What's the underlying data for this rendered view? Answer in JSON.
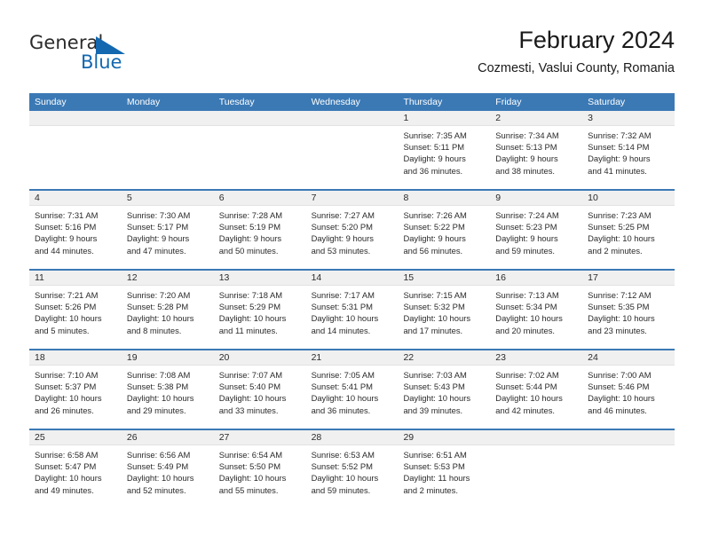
{
  "logo": {
    "word1": "General",
    "word2": "Blue",
    "triangle_color": "#1368b0"
  },
  "header": {
    "month_title": "February 2024",
    "location": "Cozmesti, Vaslui County, Romania"
  },
  "theme": {
    "header_blue": "#3b79b5",
    "banner_grey": "#f0f0f0",
    "text": "#2a2a2a"
  },
  "calendar": {
    "weekday_headers": [
      "Sunday",
      "Monday",
      "Tuesday",
      "Wednesday",
      "Thursday",
      "Friday",
      "Saturday"
    ],
    "weeks": [
      [
        {
          "day": "",
          "lines": []
        },
        {
          "day": "",
          "lines": []
        },
        {
          "day": "",
          "lines": []
        },
        {
          "day": "",
          "lines": []
        },
        {
          "day": "1",
          "lines": [
            "Sunrise: 7:35 AM",
            "Sunset: 5:11 PM",
            "Daylight: 9 hours",
            "and 36 minutes."
          ]
        },
        {
          "day": "2",
          "lines": [
            "Sunrise: 7:34 AM",
            "Sunset: 5:13 PM",
            "Daylight: 9 hours",
            "and 38 minutes."
          ]
        },
        {
          "day": "3",
          "lines": [
            "Sunrise: 7:32 AM",
            "Sunset: 5:14 PM",
            "Daylight: 9 hours",
            "and 41 minutes."
          ]
        }
      ],
      [
        {
          "day": "4",
          "lines": [
            "Sunrise: 7:31 AM",
            "Sunset: 5:16 PM",
            "Daylight: 9 hours",
            "and 44 minutes."
          ]
        },
        {
          "day": "5",
          "lines": [
            "Sunrise: 7:30 AM",
            "Sunset: 5:17 PM",
            "Daylight: 9 hours",
            "and 47 minutes."
          ]
        },
        {
          "day": "6",
          "lines": [
            "Sunrise: 7:28 AM",
            "Sunset: 5:19 PM",
            "Daylight: 9 hours",
            "and 50 minutes."
          ]
        },
        {
          "day": "7",
          "lines": [
            "Sunrise: 7:27 AM",
            "Sunset: 5:20 PM",
            "Daylight: 9 hours",
            "and 53 minutes."
          ]
        },
        {
          "day": "8",
          "lines": [
            "Sunrise: 7:26 AM",
            "Sunset: 5:22 PM",
            "Daylight: 9 hours",
            "and 56 minutes."
          ]
        },
        {
          "day": "9",
          "lines": [
            "Sunrise: 7:24 AM",
            "Sunset: 5:23 PM",
            "Daylight: 9 hours",
            "and 59 minutes."
          ]
        },
        {
          "day": "10",
          "lines": [
            "Sunrise: 7:23 AM",
            "Sunset: 5:25 PM",
            "Daylight: 10 hours",
            "and 2 minutes."
          ]
        }
      ],
      [
        {
          "day": "11",
          "lines": [
            "Sunrise: 7:21 AM",
            "Sunset: 5:26 PM",
            "Daylight: 10 hours",
            "and 5 minutes."
          ]
        },
        {
          "day": "12",
          "lines": [
            "Sunrise: 7:20 AM",
            "Sunset: 5:28 PM",
            "Daylight: 10 hours",
            "and 8 minutes."
          ]
        },
        {
          "day": "13",
          "lines": [
            "Sunrise: 7:18 AM",
            "Sunset: 5:29 PM",
            "Daylight: 10 hours",
            "and 11 minutes."
          ]
        },
        {
          "day": "14",
          "lines": [
            "Sunrise: 7:17 AM",
            "Sunset: 5:31 PM",
            "Daylight: 10 hours",
            "and 14 minutes."
          ]
        },
        {
          "day": "15",
          "lines": [
            "Sunrise: 7:15 AM",
            "Sunset: 5:32 PM",
            "Daylight: 10 hours",
            "and 17 minutes."
          ]
        },
        {
          "day": "16",
          "lines": [
            "Sunrise: 7:13 AM",
            "Sunset: 5:34 PM",
            "Daylight: 10 hours",
            "and 20 minutes."
          ]
        },
        {
          "day": "17",
          "lines": [
            "Sunrise: 7:12 AM",
            "Sunset: 5:35 PM",
            "Daylight: 10 hours",
            "and 23 minutes."
          ]
        }
      ],
      [
        {
          "day": "18",
          "lines": [
            "Sunrise: 7:10 AM",
            "Sunset: 5:37 PM",
            "Daylight: 10 hours",
            "and 26 minutes."
          ]
        },
        {
          "day": "19",
          "lines": [
            "Sunrise: 7:08 AM",
            "Sunset: 5:38 PM",
            "Daylight: 10 hours",
            "and 29 minutes."
          ]
        },
        {
          "day": "20",
          "lines": [
            "Sunrise: 7:07 AM",
            "Sunset: 5:40 PM",
            "Daylight: 10 hours",
            "and 33 minutes."
          ]
        },
        {
          "day": "21",
          "lines": [
            "Sunrise: 7:05 AM",
            "Sunset: 5:41 PM",
            "Daylight: 10 hours",
            "and 36 minutes."
          ]
        },
        {
          "day": "22",
          "lines": [
            "Sunrise: 7:03 AM",
            "Sunset: 5:43 PM",
            "Daylight: 10 hours",
            "and 39 minutes."
          ]
        },
        {
          "day": "23",
          "lines": [
            "Sunrise: 7:02 AM",
            "Sunset: 5:44 PM",
            "Daylight: 10 hours",
            "and 42 minutes."
          ]
        },
        {
          "day": "24",
          "lines": [
            "Sunrise: 7:00 AM",
            "Sunset: 5:46 PM",
            "Daylight: 10 hours",
            "and 46 minutes."
          ]
        }
      ],
      [
        {
          "day": "25",
          "lines": [
            "Sunrise: 6:58 AM",
            "Sunset: 5:47 PM",
            "Daylight: 10 hours",
            "and 49 minutes."
          ]
        },
        {
          "day": "26",
          "lines": [
            "Sunrise: 6:56 AM",
            "Sunset: 5:49 PM",
            "Daylight: 10 hours",
            "and 52 minutes."
          ]
        },
        {
          "day": "27",
          "lines": [
            "Sunrise: 6:54 AM",
            "Sunset: 5:50 PM",
            "Daylight: 10 hours",
            "and 55 minutes."
          ]
        },
        {
          "day": "28",
          "lines": [
            "Sunrise: 6:53 AM",
            "Sunset: 5:52 PM",
            "Daylight: 10 hours",
            "and 59 minutes."
          ]
        },
        {
          "day": "29",
          "lines": [
            "Sunrise: 6:51 AM",
            "Sunset: 5:53 PM",
            "Daylight: 11 hours",
            "and 2 minutes."
          ]
        },
        {
          "day": "",
          "lines": []
        },
        {
          "day": "",
          "lines": []
        }
      ]
    ]
  }
}
